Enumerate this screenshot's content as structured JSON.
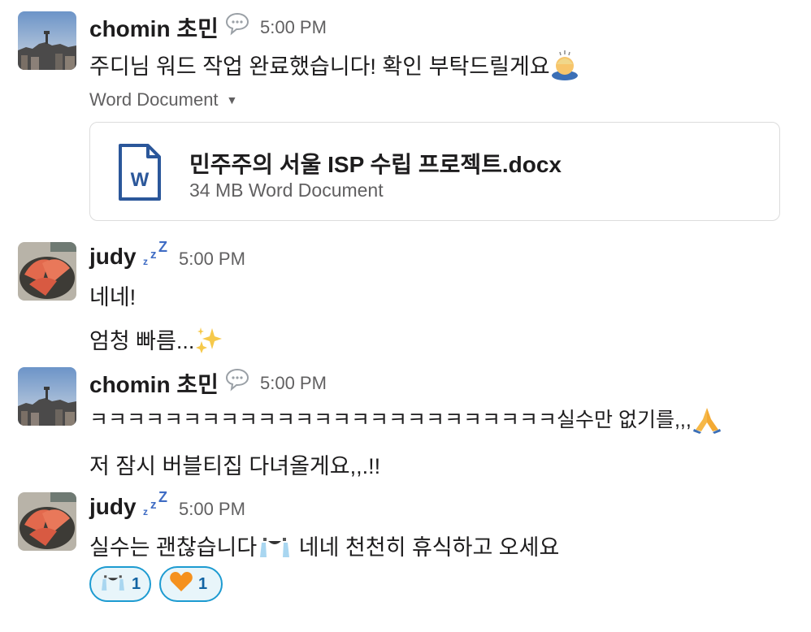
{
  "messages": [
    {
      "author": "chomin 초민",
      "status_icon": "speech-bubble-icon",
      "time": "5:00 PM",
      "lines": [
        "주디님 워드 작업 완료했습니다! 확인 부탁드릴게요"
      ],
      "trailing_emoji": "bowing-person",
      "attachment": {
        "label": "Word Document",
        "file_name": "민주주의 서울 ISP 수립 프로젝트.docx",
        "file_meta": "34 MB Word Document",
        "icon_letter": "W"
      }
    },
    {
      "author": "judy",
      "status_icon": "zzz-icon",
      "time": "5:00 PM",
      "lines": [
        "네네!",
        "엄청 빠름..."
      ],
      "trailing_emoji": "sparkles"
    },
    {
      "author": "chomin 초민",
      "status_icon": "speech-bubble-icon",
      "time": "5:00 PM",
      "lines": [
        "ㅋㅋㅋㅋㅋㅋㅋㅋㅋㅋㅋㅋㅋㅋㅋㅋㅋㅋㅋㅋㅋㅋㅋㅋㅋ실수만 없기를,,,",
        "저 잠시 버블티집 다녀올게요,,.!!"
      ],
      "trailing_emoji": "folded-hands"
    },
    {
      "author": "judy",
      "status_icon": "zzz-icon",
      "time": "5:00 PM",
      "lines": [
        "실수는 괜찮습니다",
        " 네네 천천히 휴식하고 오세요"
      ],
      "inline_emoji": "crying-face",
      "reactions": [
        {
          "emoji": "crying-face",
          "count": "1"
        },
        {
          "emoji": "orange-heart",
          "count": "1"
        }
      ]
    }
  ],
  "colors": {
    "text": "#1d1c1d",
    "muted": "#616061",
    "reaction_border": "#1d9bd1",
    "reaction_bg": "#e8f5fa",
    "reaction_count": "#1264a3",
    "word_blue": "#2b579a"
  }
}
